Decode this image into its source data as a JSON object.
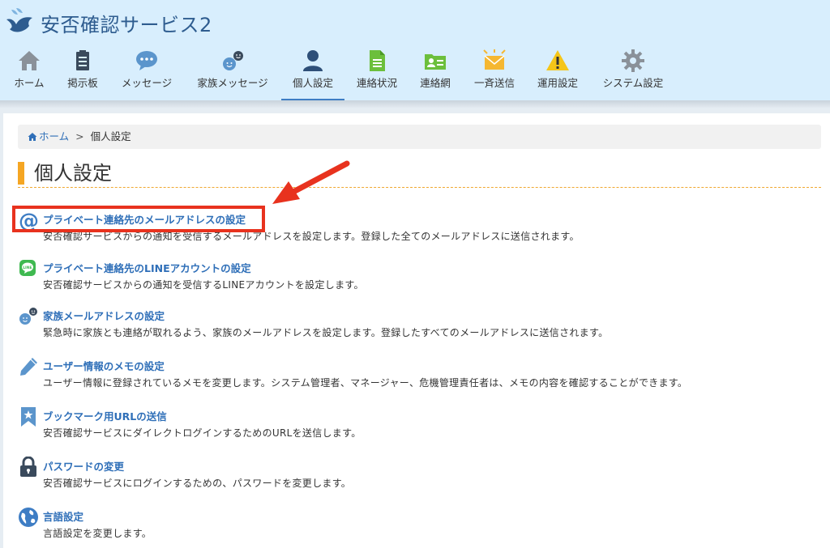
{
  "app": {
    "title": "安否確認サービス2"
  },
  "nav": [
    {
      "label": "ホーム",
      "icon": "home-icon"
    },
    {
      "label": "掲示板",
      "icon": "clipboard-icon"
    },
    {
      "label": "メッセージ",
      "icon": "chat-bubble-icon"
    },
    {
      "label": "家族メッセージ",
      "icon": "family-faces-icon"
    },
    {
      "label": "個人設定",
      "icon": "person-icon",
      "active": true
    },
    {
      "label": "連絡状況",
      "icon": "document-icon"
    },
    {
      "label": "連絡網",
      "icon": "contact-folder-icon"
    },
    {
      "label": "一斉送信",
      "icon": "broadcast-envelope-icon"
    },
    {
      "label": "運用設定",
      "icon": "warning-icon"
    },
    {
      "label": "システム設定",
      "icon": "gear-icon"
    }
  ],
  "breadcrumb": {
    "home": "ホーム",
    "separator": ">",
    "current": "個人設定"
  },
  "page": {
    "title": "個人設定"
  },
  "items": [
    {
      "title": "プライベート連絡先のメールアドレスの設定",
      "desc": "安否確認サービスからの通知を受信するメールアドレスを設定します。登録した全てのメールアドレスに送信されます。",
      "icon": "at-sign-icon"
    },
    {
      "title": "プライベート連絡先のLINEアカウントの設定",
      "desc": "安否確認サービスからの通知を受信するLINEアカウントを設定します。",
      "icon": "line-icon"
    },
    {
      "title": "家族メールアドレスの設定",
      "desc": "緊急時に家族とも連絡が取れるよう、家族のメールアドレスを設定します。登録したすべてのメールアドレスに送信されます。",
      "icon": "family-faces-icon"
    },
    {
      "title": "ユーザー情報のメモの設定",
      "desc": "ユーザー情報に登録されているメモを変更します。システム管理者、マネージャー、危機管理責任者は、メモの内容を確認することができます。",
      "icon": "pencil-icon"
    },
    {
      "title": "ブックマーク用URLの送信",
      "desc": "安否確認サービスにダイレクトログインするためのURLを送信します。",
      "icon": "bookmark-icon"
    },
    {
      "title": "パスワードの変更",
      "desc": "安否確認サービスにログインするための、パスワードを変更します。",
      "icon": "lock-icon"
    },
    {
      "title": "言語設定",
      "desc": "言語設定を変更します。",
      "icon": "globe-icon"
    }
  ],
  "colors": {
    "header_bg": "#d8eefd",
    "link": "#2f6fb8",
    "accent": "#f5a623",
    "highlight": "#e8321e"
  }
}
